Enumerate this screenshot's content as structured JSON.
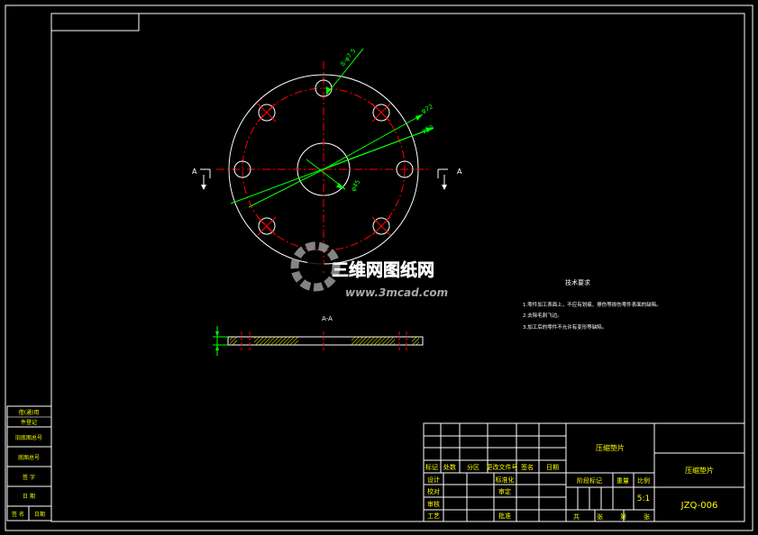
{
  "colors": {
    "background": "#000000",
    "frame": "#ffffff",
    "centerline": "#ff0000",
    "dimension": "#00ff00",
    "title_text": "#ffff00",
    "hatch": "#ffff00",
    "watermark": "#9a9a9a"
  },
  "drawing": {
    "section_label_left": "A",
    "section_label_right": "A",
    "section_view_title": "A-A",
    "dim_holes": "8-φ7.5",
    "dim_bolt_circle": "φ72",
    "dim_outer": "φ98",
    "dim_inner": "φ45"
  },
  "tech_requirements": {
    "title": "技术要求",
    "items": [
      "1.零件加工表面上，不应有划痕、擦伤等损伤零件表面的缺陷。",
      "2.去除毛刺飞边。",
      "3.加工后的零件不允许有变形等缺陷。"
    ]
  },
  "watermark": {
    "brand": "三维网图纸网",
    "url": "www.3mcad.com"
  },
  "left_strip": {
    "rows": [
      "借(通)用",
      "件登记",
      "旧底图总号",
      "底图总号",
      "签 字",
      "日 期"
    ],
    "bottom": [
      "签 名",
      "日期"
    ]
  },
  "title_block": {
    "header_labels": [
      "标记",
      "处数",
      "分区",
      "更改文件号",
      "签名",
      "日期"
    ],
    "role_labels": [
      "设计",
      "校对",
      "审核",
      "工艺"
    ],
    "role_labels_right": [
      "标准化",
      "审定",
      "批准"
    ],
    "part_name_center": "压缩垫片",
    "part_name_right": "压缩垫片",
    "stage_label": "阶段标记",
    "weight_label": "重量",
    "scale_label": "比例",
    "scale_value": "5:1",
    "drawing_number": "JZQ-006",
    "sheets": [
      "共",
      "张",
      "第",
      "张"
    ]
  }
}
